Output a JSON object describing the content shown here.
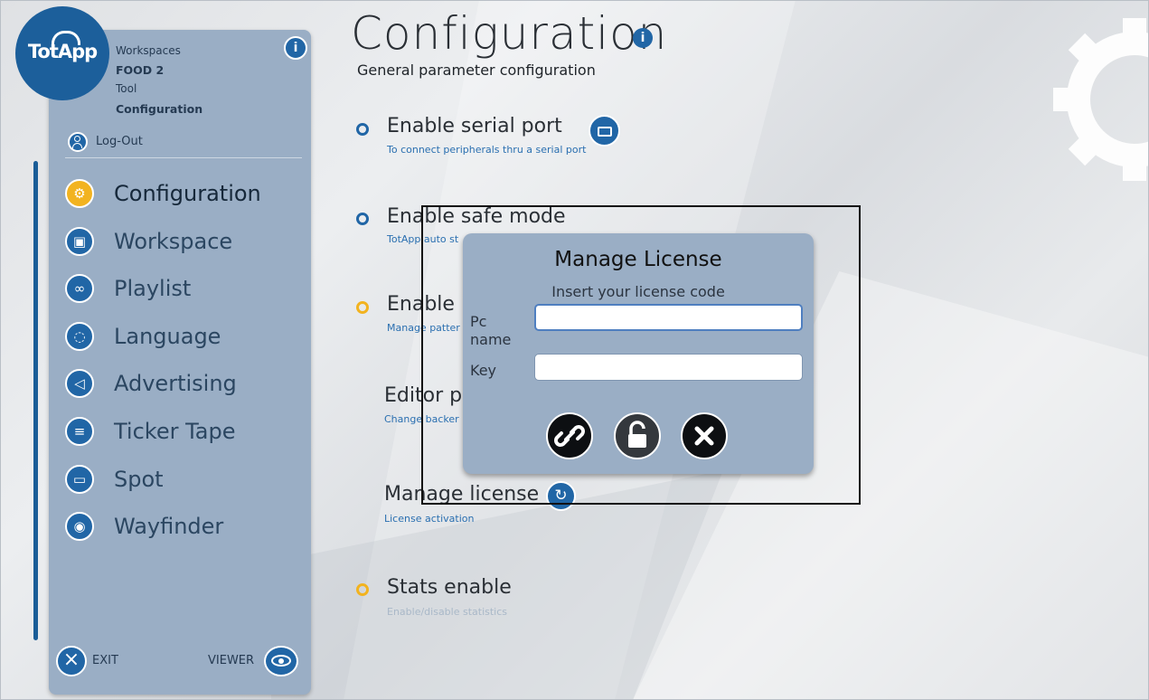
{
  "logo": {
    "text": "TotApp"
  },
  "sidebar": {
    "workspaces_label": "Workspaces",
    "workspace_name": "FOOD 2",
    "tool_label": "Tool",
    "tool_name": "Configuration",
    "logout_label": "Log-Out",
    "items": [
      {
        "label": "Configuration",
        "icon": "gear-icon",
        "active": true
      },
      {
        "label": "Workspace",
        "icon": "briefcase-icon",
        "active": false
      },
      {
        "label": "Playlist",
        "icon": "share-icon",
        "active": false
      },
      {
        "label": "Language",
        "icon": "chat-icon",
        "active": false
      },
      {
        "label": "Advertising",
        "icon": "megaphone-icon",
        "active": false
      },
      {
        "label": "Ticker Tape",
        "icon": "ticker-icon",
        "active": false
      },
      {
        "label": "Spot",
        "icon": "video-icon",
        "active": false
      },
      {
        "label": "Wayfinder",
        "icon": "location-pin-icon",
        "active": false
      }
    ],
    "exit_label": "EXIT",
    "viewer_label": "VIEWER"
  },
  "main": {
    "title": "Configuration",
    "subtitle": "General parameter configuration",
    "options": [
      {
        "title": "Enable serial port",
        "desc": "To connect peripherals thru a serial port"
      },
      {
        "title": "Enable safe mode",
        "desc": "TotApp auto st"
      },
      {
        "title": "Enable",
        "desc": "Manage patter"
      },
      {
        "title": "Editor pa",
        "desc": "Change backer"
      },
      {
        "title": "Manage license",
        "desc": "License activation"
      },
      {
        "title": "Stats enable",
        "desc": "Enable/disable statistics"
      }
    ]
  },
  "modal": {
    "title": "Manage License",
    "subtitle": "Insert your license code",
    "pc_name_label_1": "Pc",
    "pc_name_label_2": "name",
    "key_label": "Key",
    "pc_name_value": "",
    "key_value": ""
  },
  "colors": {
    "accent_blue": "#2166a6",
    "accent_yellow": "#f2b320",
    "sidebar_bg": "#9aaec5"
  }
}
